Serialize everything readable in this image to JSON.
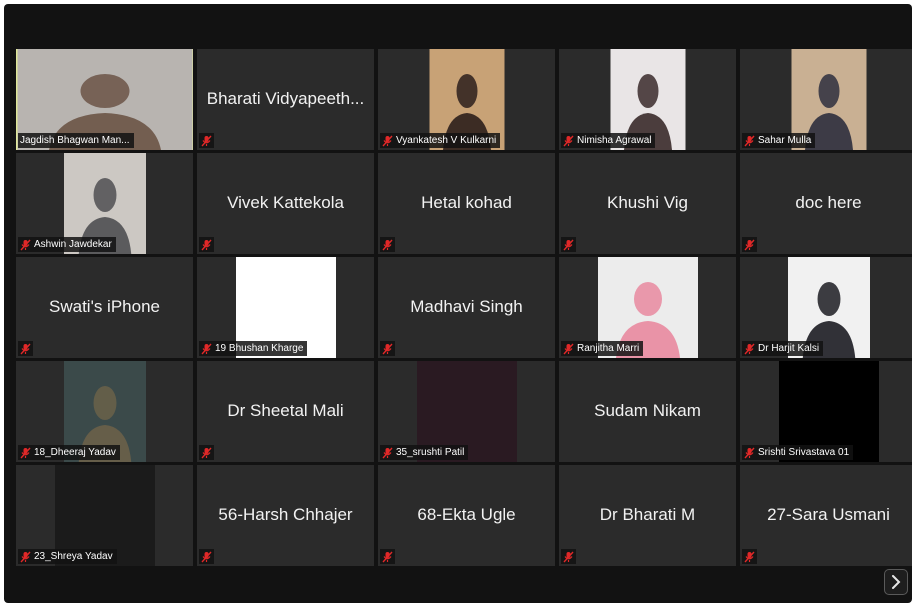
{
  "gallery": {
    "participants": [
      {
        "name": "Jagdish Bhagwan Man...",
        "video": true,
        "active": true,
        "muted": false,
        "bg": "#b8b4b0",
        "fg": "#6b5446"
      },
      {
        "display": "Bharati Vidyapeeth...",
        "muted": true
      },
      {
        "name": "Vyankatesh V Kulkarni",
        "video": true,
        "muted": true,
        "bg": "#c8a276",
        "fg": "#2c1f1c"
      },
      {
        "name": "Nimisha Agrawal",
        "video": true,
        "muted": true,
        "bg": "#e9e5e6",
        "fg": "#3a2a2a"
      },
      {
        "name": "Sahar Mulla",
        "video": true,
        "muted": true,
        "bg": "#c9b093",
        "fg": "#2e2f3e"
      },
      {
        "name": "Ashwin Jawdekar",
        "video": true,
        "muted": true,
        "bg": "#ccc8c3",
        "fg": "#4f4f52"
      },
      {
        "display": "Vivek Kattekola",
        "muted": true
      },
      {
        "display": "Hetal kohad",
        "muted": true
      },
      {
        "display": "Khushi Vig",
        "muted": true
      },
      {
        "display": "doc here",
        "muted": true
      },
      {
        "display": "Swati's iPhone",
        "muted": true
      },
      {
        "name": "19 Bhushan Kharge",
        "video": true,
        "muted": true,
        "bg": "#ffffff",
        "fg": "#ffffff"
      },
      {
        "display": "Madhavi Singh",
        "muted": true
      },
      {
        "name": "Ranjitha Marri",
        "video": true,
        "muted": true,
        "bg": "#ececec",
        "fg": "#e98aa0"
      },
      {
        "name": "Dr Harjit Kalsi",
        "video": true,
        "muted": true,
        "bg": "#f1f1f1",
        "fg": "#1c1c22"
      },
      {
        "name": "18_Dheeraj Yadav",
        "video": true,
        "muted": true,
        "bg": "#3b4a4a",
        "fg": "#6b6149"
      },
      {
        "display": "Dr Sheetal Mali",
        "muted": true
      },
      {
        "name": "35_srushti Patil",
        "video": true,
        "muted": true,
        "bg": "#2a1a22",
        "fg": "#2a1a22"
      },
      {
        "display": "Sudam Nikam",
        "muted": false
      },
      {
        "name": "Srishti Srivastava 01",
        "video": true,
        "muted": true,
        "bg": "#000000",
        "fg": "#000000"
      },
      {
        "name": "23_Shreya Yadav",
        "video": true,
        "muted": true,
        "bg": "#1b1b1b",
        "fg": "#1b1b1b"
      },
      {
        "display": "56-Harsh Chhajer",
        "muted": true
      },
      {
        "display": "68-Ekta Ugle",
        "muted": true
      },
      {
        "display": "Dr Bharati M",
        "muted": true
      },
      {
        "display": "27-Sara Usmani",
        "muted": true
      }
    ]
  },
  "icons": {
    "mute": "muted-microphone-icon",
    "next": "chevron-right-icon"
  },
  "colors": {
    "background": "#121212",
    "tile": "#2b2b2b",
    "active_border": "#dfe89b",
    "mute_red": "#e02828"
  }
}
